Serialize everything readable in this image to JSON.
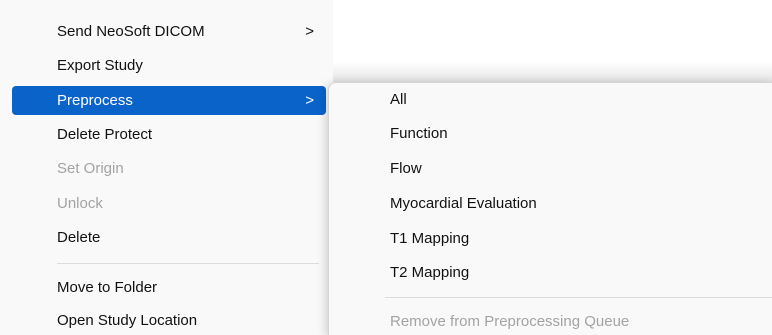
{
  "menu": {
    "items": [
      {
        "label": "Send NeoSoft DICOM",
        "submenu_indicator": ">"
      },
      {
        "label": "Export Study"
      },
      {
        "label": "Preprocess",
        "submenu_indicator": ">"
      },
      {
        "label": "Delete Protect"
      },
      {
        "label": "Set Origin"
      },
      {
        "label": "Unlock"
      },
      {
        "label": "Delete"
      },
      {
        "label": "Move to Folder"
      },
      {
        "label": "Open Study Location"
      }
    ]
  },
  "submenu": {
    "items": [
      {
        "label": "All"
      },
      {
        "label": "Function"
      },
      {
        "label": "Flow"
      },
      {
        "label": "Myocardial Evaluation"
      },
      {
        "label": "T1 Mapping"
      },
      {
        "label": "T2 Mapping"
      },
      {
        "label": "Remove from Preprocessing Queue"
      }
    ]
  },
  "colors": {
    "highlight": "#0a63c9",
    "disabled_text": "#a3a3a3",
    "menu_background": "#f9f9f9"
  }
}
